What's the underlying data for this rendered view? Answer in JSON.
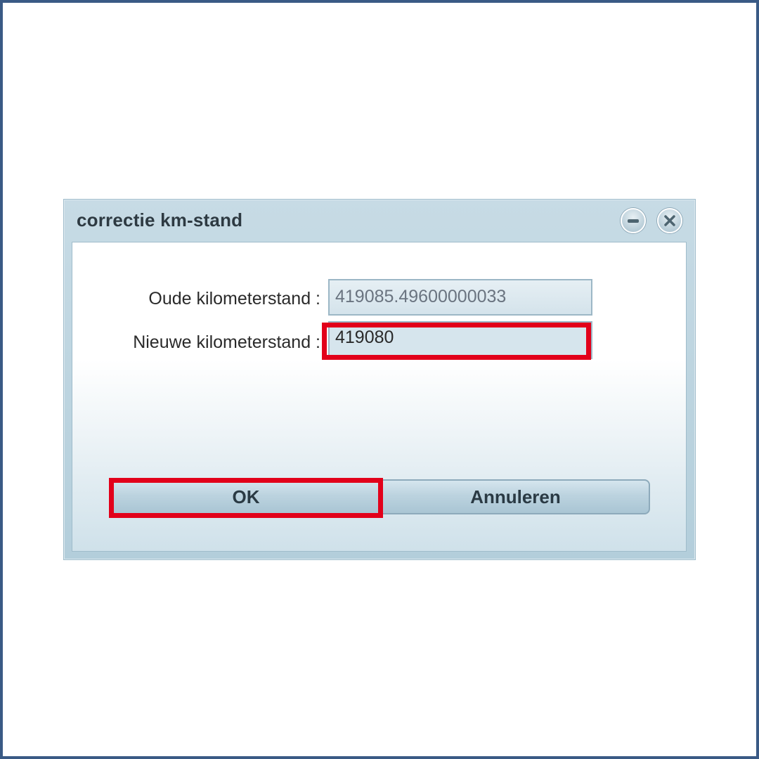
{
  "dialog": {
    "title": "correctie km-stand",
    "minimize_icon": "minimize-icon",
    "close_icon": "close-icon",
    "old_label": "Oude kilometerstand :",
    "old_value": "419085.49600000033",
    "new_label": "Nieuwe kilometerstand :",
    "new_value": "419080",
    "ok_label": "OK",
    "cancel_label": "Annuleren"
  },
  "colors": {
    "highlight": "#e2001a",
    "frame_border": "#3a5a85",
    "dialog_bg": "#c7dbe5"
  }
}
